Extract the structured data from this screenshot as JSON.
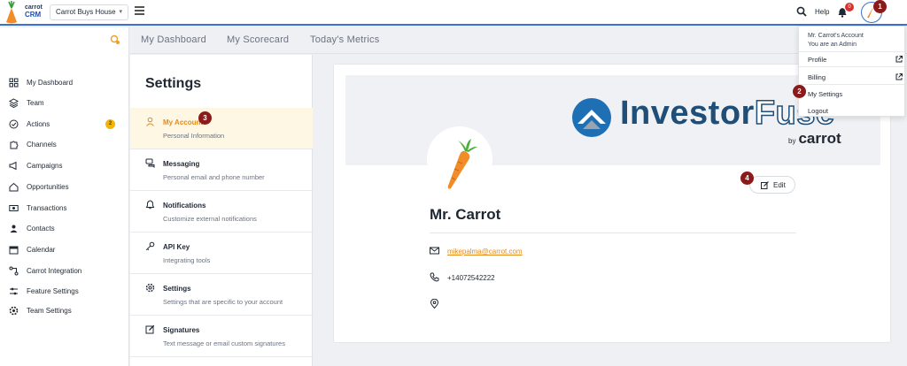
{
  "topbar": {
    "brand_line1": "carrot",
    "brand_line2": "CRM",
    "company": "Carrot Buys House",
    "help": "Help",
    "notification_count": "0"
  },
  "markers": [
    "1",
    "2",
    "3",
    "4"
  ],
  "sidebar": {
    "items": [
      {
        "label": "My Dashboard",
        "icon": "dashboard-icon"
      },
      {
        "label": "Team",
        "icon": "layers-icon"
      },
      {
        "label": "Actions",
        "icon": "check-circle-icon",
        "badge": "2"
      },
      {
        "label": "Channels",
        "icon": "puzzle-icon"
      },
      {
        "label": "Campaigns",
        "icon": "megaphone-icon"
      },
      {
        "label": "Opportunities",
        "icon": "home-icon"
      },
      {
        "label": "Transactions",
        "icon": "dollar-icon"
      },
      {
        "label": "Contacts",
        "icon": "users-icon"
      },
      {
        "label": "Calendar",
        "icon": "calendar-icon"
      },
      {
        "label": "Carrot Integration",
        "icon": "integration-icon"
      },
      {
        "label": "Feature Settings",
        "icon": "sliders-icon"
      },
      {
        "label": "Team Settings",
        "icon": "gear-icon"
      }
    ]
  },
  "tabs": [
    "My Dashboard",
    "My Scorecard",
    "Today's Metrics"
  ],
  "settings": {
    "title": "Settings",
    "items": [
      {
        "title": "My Account",
        "subtitle": "Personal Information",
        "icon": "user-icon"
      },
      {
        "title": "Messaging",
        "subtitle": "Personal email and phone number",
        "icon": "chat-icon"
      },
      {
        "title": "Notifications",
        "subtitle": "Customize external notifications",
        "icon": "bell-icon"
      },
      {
        "title": "API Key",
        "subtitle": "Integrating tools",
        "icon": "key-icon"
      },
      {
        "title": "Settings",
        "subtitle": "Settings that are specific to your account",
        "icon": "gear-icon"
      },
      {
        "title": "Signatures",
        "subtitle": "Text message or email custom signatures",
        "icon": "edit-icon"
      }
    ]
  },
  "profile": {
    "logo_main": "Investor",
    "logo_accent": "Fuse",
    "logo_by": "by",
    "logo_brand": "carrot",
    "edit": "Edit",
    "name": "Mr. Carrot",
    "email": "mikepalma@carrot.com",
    "phone": "+14072542222"
  },
  "dropdown": {
    "account_line": "Mr. Carrot's Account",
    "role_line": "You are an Admin",
    "items": [
      "Profile",
      "Billing",
      "My Settings",
      "Logout"
    ]
  },
  "colors": {
    "accent_orange": "#e88a1a",
    "brand_blue": "#1f4e79",
    "marker_red": "#8b1a1a",
    "topbar_border": "#3d6fd0"
  }
}
